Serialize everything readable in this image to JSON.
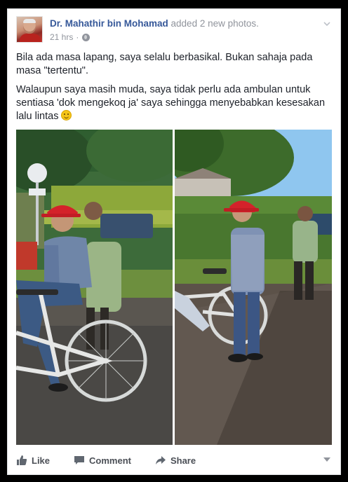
{
  "post": {
    "author": "Dr. Mahathir bin Mohamad",
    "action": "added 2 new photos.",
    "time": "21 hrs",
    "separator": "·",
    "paragraphs": [
      "Bila ada masa lapang, saya selalu berbasikal. Bukan sahaja pada masa \"tertentu\".",
      "Walaupun saya masih muda, saya tidak perlu ada ambulan untuk sentiasa 'dok mengekoq ja' saya sehingga menyebabkan kesesakan lalu lintas"
    ],
    "emoji_icon": "smile-icon",
    "photos": [
      {
        "icon": "photo-cycling"
      },
      {
        "icon": "photo-standing-by-bicycle"
      }
    ]
  },
  "actions": {
    "like": "Like",
    "comment": "Comment",
    "share": "Share"
  },
  "colors": {
    "author_link": "#365899",
    "muted": "#90949c",
    "text": "#1d2129",
    "action_text": "#4b4f56"
  }
}
